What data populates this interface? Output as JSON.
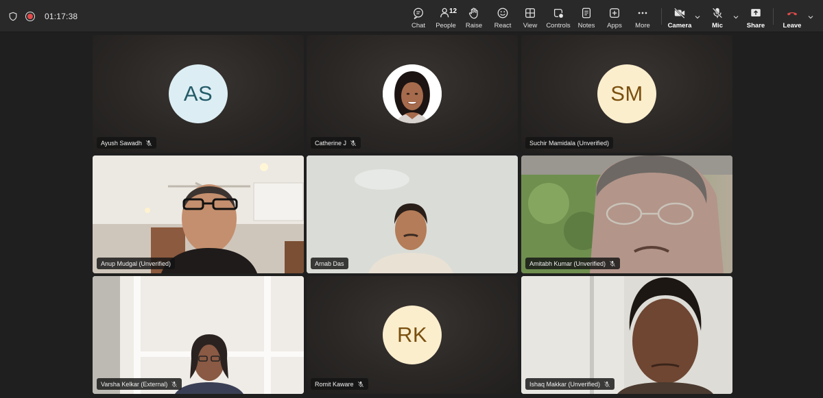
{
  "meeting": {
    "timer": "01:17:38"
  },
  "toolbar": {
    "chat": "Chat",
    "people": "People",
    "people_count": "12",
    "raise": "Raise",
    "react": "React",
    "view": "View",
    "controls": "Controls",
    "notes": "Notes",
    "apps": "Apps",
    "more": "More",
    "camera": "Camera",
    "mic": "Mic",
    "share": "Share",
    "leave": "Leave"
  },
  "participants": [
    {
      "name": "Ayush Sawadh",
      "initials": "AS",
      "muted": true
    },
    {
      "name": "Catherine J",
      "initials": "",
      "muted": true
    },
    {
      "name": "Suchir Mamidala (Unverified)",
      "initials": "SM",
      "muted": false
    },
    {
      "name": "Anup Mudgal (Unverified)",
      "initials": "",
      "muted": false
    },
    {
      "name": "Arnab Das",
      "initials": "",
      "muted": false
    },
    {
      "name": "Amitabh Kumar (Unverified)",
      "initials": "",
      "muted": true
    },
    {
      "name": "Varsha Kelkar (External)",
      "initials": "",
      "muted": true
    },
    {
      "name": "Romit Kaware",
      "initials": "RK",
      "muted": true
    },
    {
      "name": "Ishaq Makkar (Unverified)",
      "initials": "",
      "muted": true
    }
  ],
  "colors": {
    "leave": "#e34b4b",
    "active_speaker": "#7f85f5"
  }
}
